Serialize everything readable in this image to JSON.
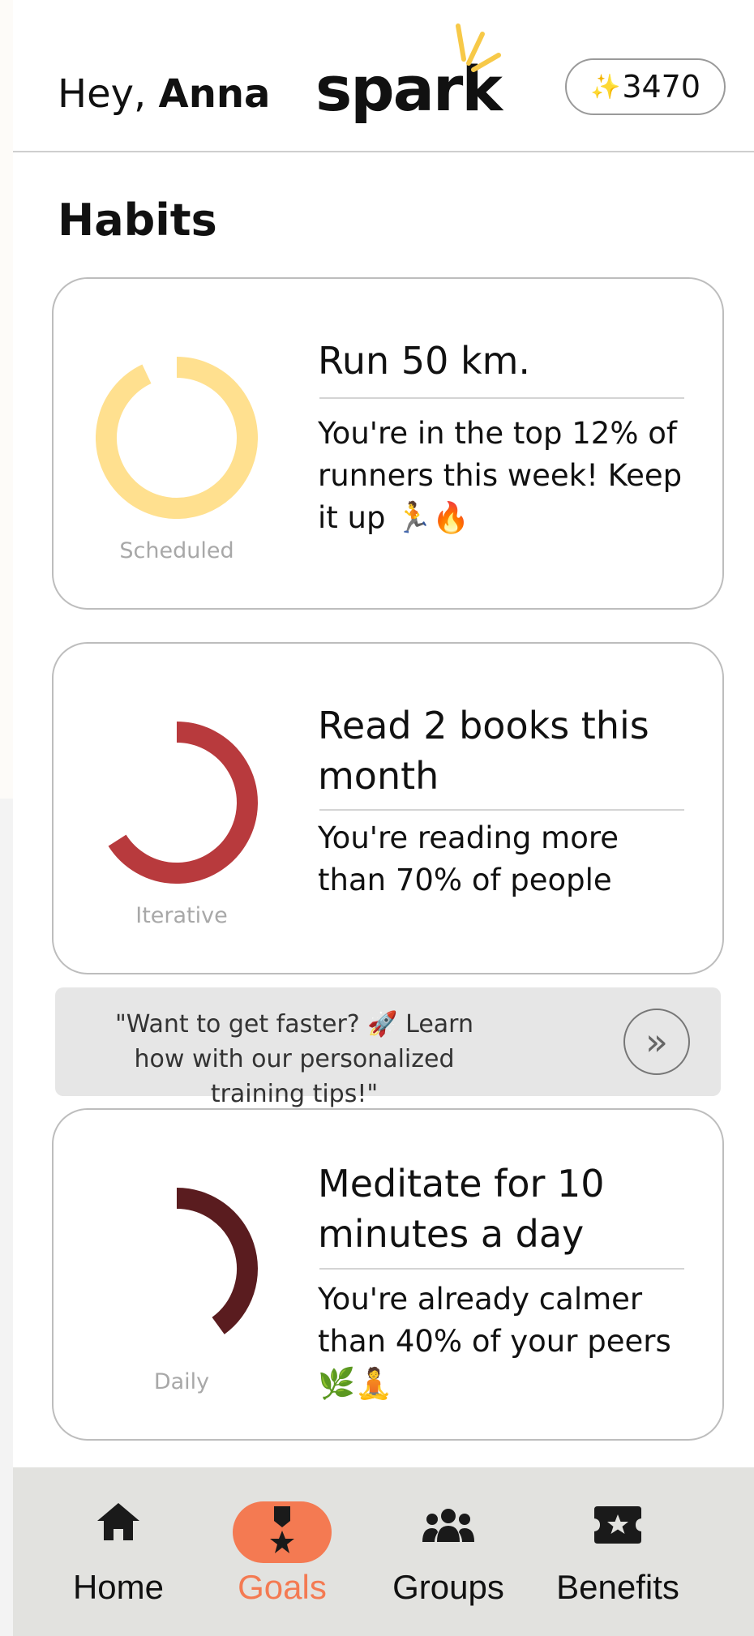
{
  "header": {
    "greeting_prefix": "Hey, ",
    "user_name": "Anna",
    "logo": "spark",
    "points_icon": "✨",
    "points": "3470"
  },
  "section_title": "Habits",
  "habits": [
    {
      "type": "Scheduled",
      "title": "Run 50 km.",
      "message": "You're in the top 12% of runners this week! Keep it up 🏃🔥",
      "progress": 0.93,
      "color": "#ffe08f"
    },
    {
      "type": "Iterative",
      "title": "Read 2 books this month",
      "message": "You're reading more than 70% of people",
      "progress": 0.66,
      "color": "#b83a3d"
    },
    {
      "type": "Daily",
      "title": "Meditate for 10 minutes a day",
      "message": "You're already calmer than 40% of your peers 🌿🧘",
      "progress": 0.4,
      "color": "#5a1c1f"
    }
  ],
  "promo": {
    "text": "\"Want to get faster? 🚀 Learn how with our personalized training tips!\"",
    "button_icon": "double-chevron-right-icon"
  },
  "nav": {
    "items": [
      {
        "label": "Home",
        "icon": "home-icon"
      },
      {
        "label": "Goals",
        "icon": "medal-icon",
        "active": true
      },
      {
        "label": "Groups",
        "icon": "users-icon"
      },
      {
        "label": "Benefits",
        "icon": "ticket-icon"
      }
    ],
    "active_color": "#f47a52"
  }
}
